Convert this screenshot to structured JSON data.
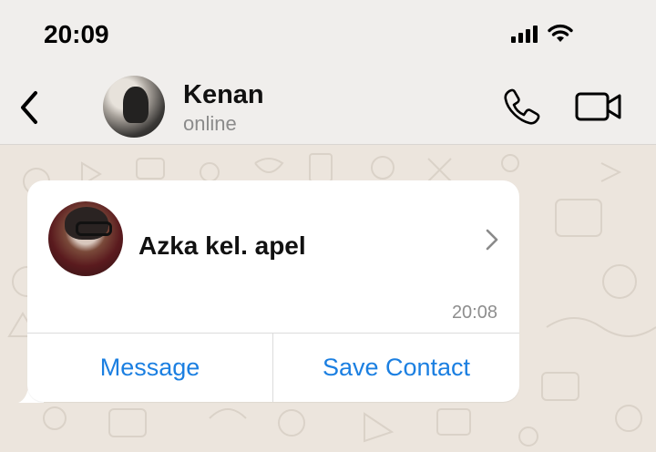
{
  "status_bar": {
    "time": "20:09",
    "icons": [
      "signal-icon",
      "wifi-icon"
    ]
  },
  "header": {
    "back_icon": "chevron-left-icon",
    "contact_name": "Kenan",
    "contact_status": "online",
    "call_icon": "phone-icon",
    "video_icon": "video-camera-icon"
  },
  "contact_card": {
    "name": "Azka kel. apel",
    "timestamp": "20:08",
    "buttons": {
      "message": "Message",
      "save_contact": "Save Contact"
    }
  },
  "colors": {
    "header_bg": "#f0eeec",
    "chat_bg": "#ece5dd",
    "link_blue": "#1b7fe1"
  }
}
